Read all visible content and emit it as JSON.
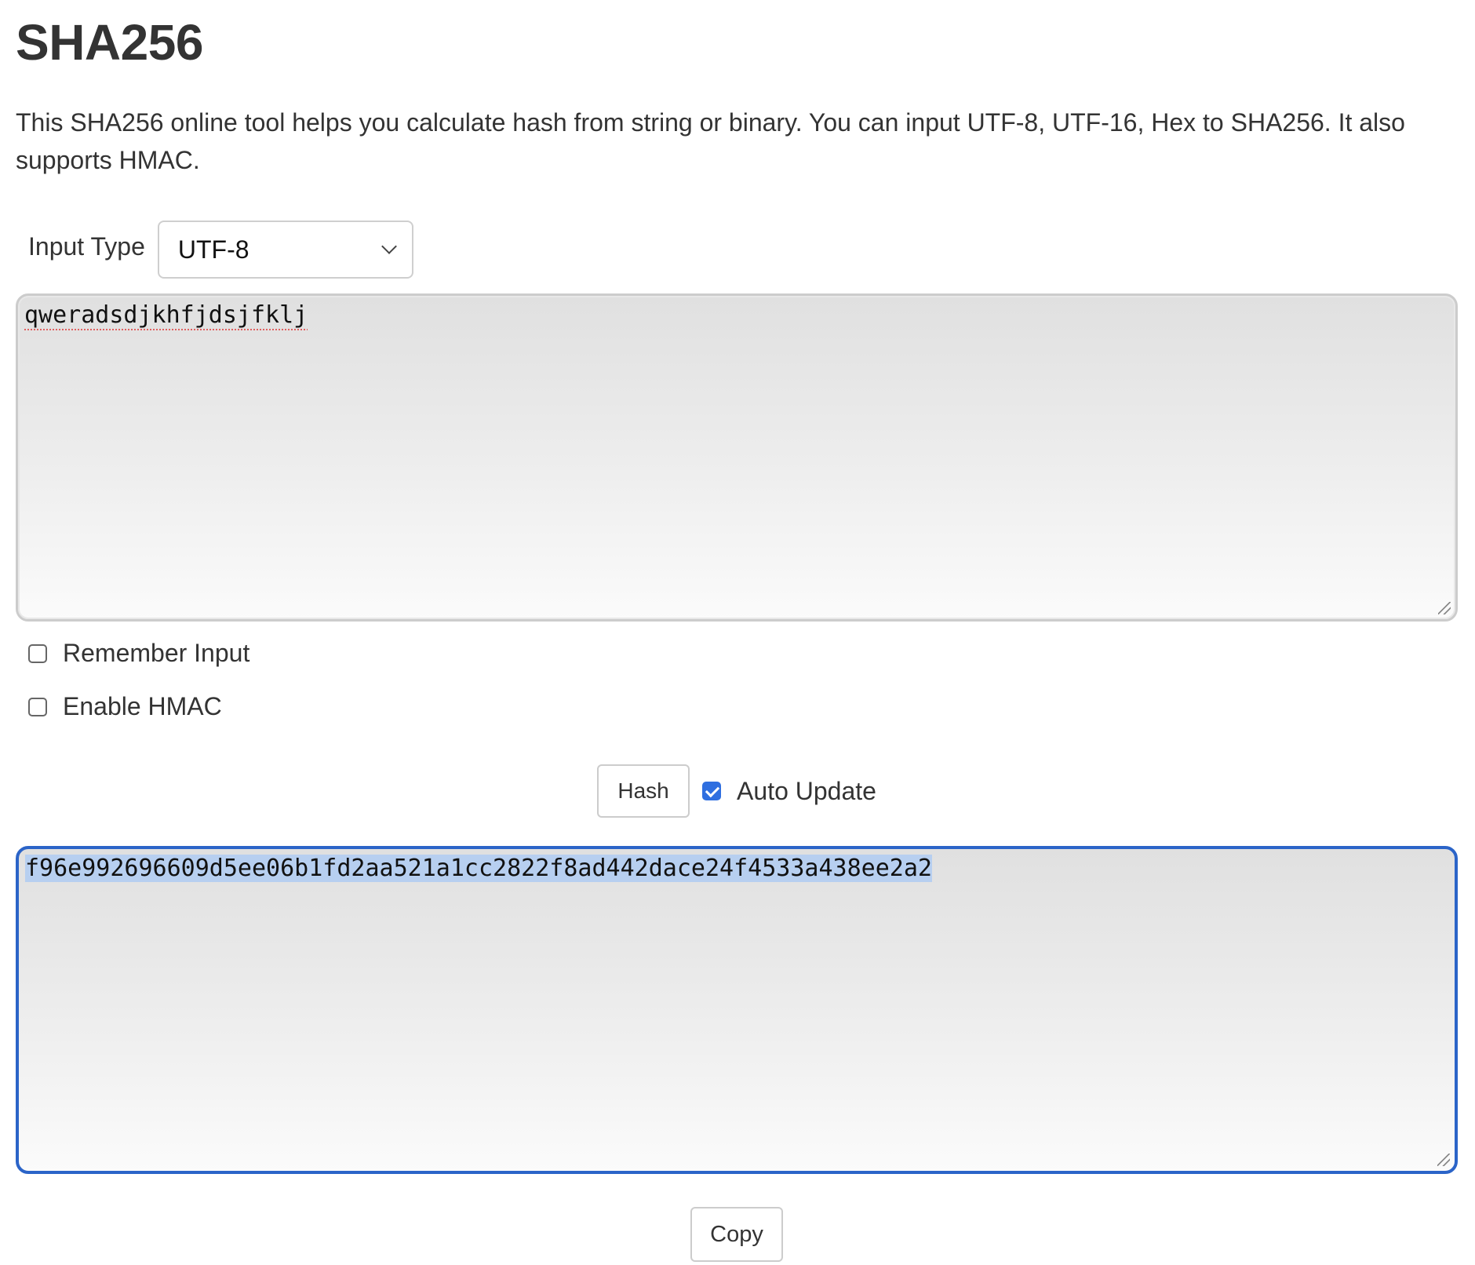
{
  "page": {
    "title": "SHA256",
    "description": "This SHA256 online tool helps you calculate hash from string or binary. You can input UTF-8, UTF-16, Hex to SHA256. It also supports HMAC."
  },
  "input_type": {
    "label": "Input Type",
    "selected": "UTF-8"
  },
  "input": {
    "value": "qweradsdjkhfjdsjfklj"
  },
  "options": {
    "remember_input": {
      "label": "Remember Input",
      "checked": false
    },
    "enable_hmac": {
      "label": "Enable HMAC",
      "checked": false
    }
  },
  "actions": {
    "hash_label": "Hash",
    "auto_update": {
      "label": "Auto Update",
      "checked": true
    },
    "copy_label": "Copy"
  },
  "output": {
    "value": "f96e992696609d5ee06b1fd2aa521a1cc2822f8ad442dace24f4533a438ee2a2"
  },
  "colors": {
    "accent": "#2b64c8",
    "selection": "#b7cff0",
    "text": "#333333"
  }
}
